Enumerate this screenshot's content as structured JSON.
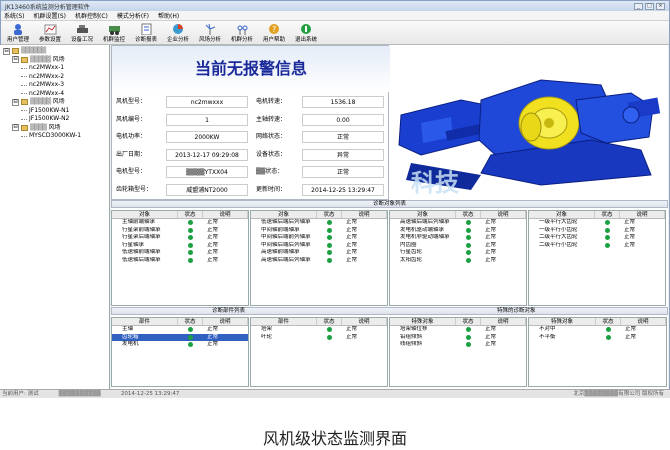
{
  "window": {
    "title": "JK13460系统监测分析管理软件",
    "controls": [
      "_",
      "□",
      "×"
    ]
  },
  "menu": [
    "系统(S)",
    "机群设置(S)",
    "机群控制(C)",
    "模式分析(F)",
    "帮助(H)"
  ],
  "toolbar": [
    {
      "label": "用户管理",
      "icon": "user-manage-icon"
    },
    {
      "label": "参数设置",
      "icon": "chart-settings-icon"
    },
    {
      "label": "设备工况",
      "icon": "device-status-icon"
    },
    {
      "label": "机群监控",
      "icon": "monitor-icon"
    },
    {
      "label": "诊断报表",
      "icon": "report-icon"
    },
    {
      "label": "企业分析",
      "icon": "pie-analysis-icon"
    },
    {
      "label": "风场分析",
      "icon": "windfarm-icon"
    },
    {
      "label": "机群分析",
      "icon": "cluster-icon"
    },
    {
      "label": "用户帮助",
      "icon": "help-icon"
    },
    {
      "label": "退出系统",
      "icon": "exit-icon"
    }
  ],
  "tree": [
    {
      "indent": 0,
      "exp": "⊟",
      "blur": "▒▒▒▒▒▒",
      "text": ""
    },
    {
      "indent": 1,
      "exp": "⊟",
      "blur": "▒▒▒▒▒",
      "text": "风场"
    },
    {
      "indent": 2,
      "exp": "",
      "blur": "",
      "text": "nc2MWxx-1"
    },
    {
      "indent": 2,
      "exp": "",
      "blur": "",
      "text": "nc2MWxx-2"
    },
    {
      "indent": 2,
      "exp": "",
      "blur": "",
      "text": "nc2MWxx-3"
    },
    {
      "indent": 2,
      "exp": "",
      "blur": "",
      "text": "nc2MWxx-4"
    },
    {
      "indent": 1,
      "exp": "⊟",
      "blur": "▒▒▒▒▒",
      "text": "风场"
    },
    {
      "indent": 2,
      "exp": "",
      "blur": "",
      "text": "JF1500KW-N1"
    },
    {
      "indent": 2,
      "exp": "",
      "blur": "",
      "text": "JF1500KW-N2"
    },
    {
      "indent": 1,
      "exp": "⊟",
      "blur": "▒▒▒▒",
      "text": "风场"
    },
    {
      "indent": 2,
      "exp": "",
      "blur": "",
      "text": "MYSCD3000KW-1"
    }
  ],
  "alarm_title": "当前无报警信息",
  "info": {
    "left": [
      {
        "label": "风机型号：",
        "value": "nc2mwxxx"
      },
      {
        "label": "风机编号：",
        "value": "1"
      },
      {
        "label": "电机功率：",
        "value": "2000KW"
      },
      {
        "label": "出厂日期：",
        "value": "2013-12-17 09:29:08"
      },
      {
        "label": "电机型号：",
        "value": "▒▒▒▒YTXX04"
      },
      {
        "label": "齿轮箱型号：",
        "value": "威盟浦NT2000"
      }
    ],
    "right": [
      {
        "label": "电机转速：",
        "value": "1536.18"
      },
      {
        "label": "主轴转速：",
        "value": "0.00"
      },
      {
        "label": "网络状态：",
        "value": "正常"
      },
      {
        "label": "设备状态：",
        "value": "异常"
      },
      {
        "label": "▒▒状态：",
        "value": "正常"
      },
      {
        "label": "更新时间：",
        "value": "2014-12-25 13:29:47"
      }
    ]
  },
  "watermark": "科技",
  "sections": {
    "diag": "诊断对象列表",
    "parts": "诊断部件列表",
    "special": "特殊的诊断对象"
  },
  "headers": {
    "obj": "对象",
    "state": "状态",
    "desc": "说明",
    "part": "部件",
    "special": "特殊对象"
  },
  "diag_cols": [
    {
      "objects": [
        "主轴前端轴承",
        "行星架前端轴承",
        "行星架后端轴承",
        "行星轴承",
        "低速轴前端轴承",
        "低速轴后端轴承"
      ],
      "desc": [
        "正常",
        "正常",
        "正常",
        "正常",
        "正常",
        "正常"
      ]
    },
    {
      "objects": [
        "低速轴后端后列轴承",
        "中间轴前端轴承",
        "中间轴后端前列轴承",
        "中间轴后端后列轴承",
        "高速轴前端轴承",
        "高速轴后端后列轴承"
      ],
      "desc": [
        "正常",
        "正常",
        "正常",
        "正常",
        "正常",
        "正常"
      ]
    },
    {
      "objects": [
        "高速轴后端后列轴承",
        "发电机驱动端轴承",
        "发电机非驱动端轴承",
        "内齿圈",
        "行星齿轮",
        "太阳齿轮"
      ],
      "desc": [
        "正常",
        "正常",
        "正常",
        "正常",
        "正常",
        "正常"
      ]
    },
    {
      "objects": [
        "一级平行大齿轮",
        "一级平行小齿轮",
        "二级平行大齿轮",
        "二级平行小齿轮"
      ],
      "desc": [
        "正常",
        "正常",
        "正常",
        "正常"
      ]
    }
  ],
  "parts_a": [
    {
      "name": "主轴",
      "desc": "正常",
      "sel": false
    },
    {
      "name": "齿轮箱",
      "desc": "正常",
      "sel": true
    },
    {
      "name": "发电机",
      "desc": "正常",
      "sel": false
    }
  ],
  "parts_b": [
    {
      "name": "塔架",
      "desc": "正常"
    },
    {
      "name": "叶轮",
      "desc": "正常"
    }
  ],
  "special": [
    {
      "name": "塔架轴位移",
      "desc": "正常"
    },
    {
      "name": "铅组倾斜",
      "desc": "正常"
    },
    {
      "name": "线组倾斜",
      "desc": "正常"
    }
  ],
  "special2": [
    {
      "name": "不对中",
      "desc": "正常"
    },
    {
      "name": "不平衡",
      "desc": "正常"
    }
  ],
  "status_bar": [
    "当前用户: 测试",
    "▒▒▒▒▒▒▒▒▒▒",
    "2014-12-25 13:29:47",
    "北京▒▒▒▒▒▒▒▒有限公司 版权所有"
  ],
  "caption": "风机级状态监测界面",
  "colors": {
    "ok_dot": "#1aa040",
    "alarm_title": "#1a2a9a",
    "selected": "#3060c0"
  }
}
